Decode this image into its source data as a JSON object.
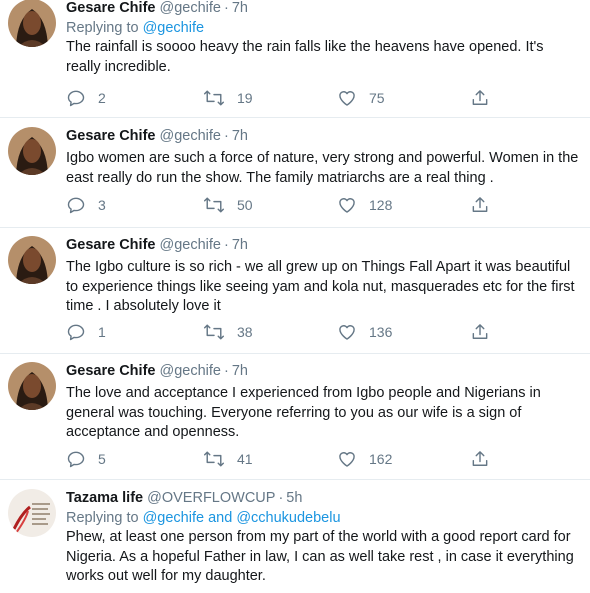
{
  "tweets": [
    {
      "name": "Gesare Chife",
      "handle": "@gechife",
      "time": "7h",
      "replying_label": "Replying to",
      "replying_to": "@gechife",
      "text": "The rainfall is soooo heavy the rain falls like the heavens have opened. It's really incredible.",
      "replies": "2",
      "retweets": "19",
      "likes": "75"
    },
    {
      "name": "Gesare Chife",
      "handle": "@gechife",
      "time": "7h",
      "text": "Igbo women are such a force of nature, very strong and powerful. Women in the east really do run the show. The family matriarchs are a real thing .",
      "replies": "3",
      "retweets": "50",
      "likes": "128"
    },
    {
      "name": "Gesare Chife",
      "handle": "@gechife",
      "time": "7h",
      "text": "The Igbo culture is so rich - we all grew up on Things Fall Apart it was beautiful to experience things like seeing yam and kola nut, masquerades etc for the first time . I absolutely love it",
      "replies": "1",
      "retweets": "38",
      "likes": "136"
    },
    {
      "name": "Gesare Chife",
      "handle": "@gechife",
      "time": "7h",
      "text": "The love and acceptance I experienced from Igbo people and Nigerians in general was touching. Everyone referring to you as our wife is a sign of acceptance and openness.",
      "replies": "5",
      "retweets": "41",
      "likes": "162"
    },
    {
      "name": "Tazama life",
      "handle": "@OVERFLOWCUP",
      "time": "5h",
      "replying_label": "Replying to",
      "replying_to": "@gechife",
      "replying_and": "and",
      "replying_to_2": "@cchukudebelu",
      "text": "Phew, at least one person from my part of the world with a good report card for Nigeria. As a hopeful Father in law, I can as well take rest , in case  it everything works out well for my daughter."
    }
  ],
  "colors": {
    "text": "#14171a",
    "muted": "#657786",
    "link": "#1b95e0",
    "divider": "#e6ecf0"
  },
  "icons": [
    "reply-icon",
    "retweet-icon",
    "like-icon",
    "share-icon"
  ]
}
